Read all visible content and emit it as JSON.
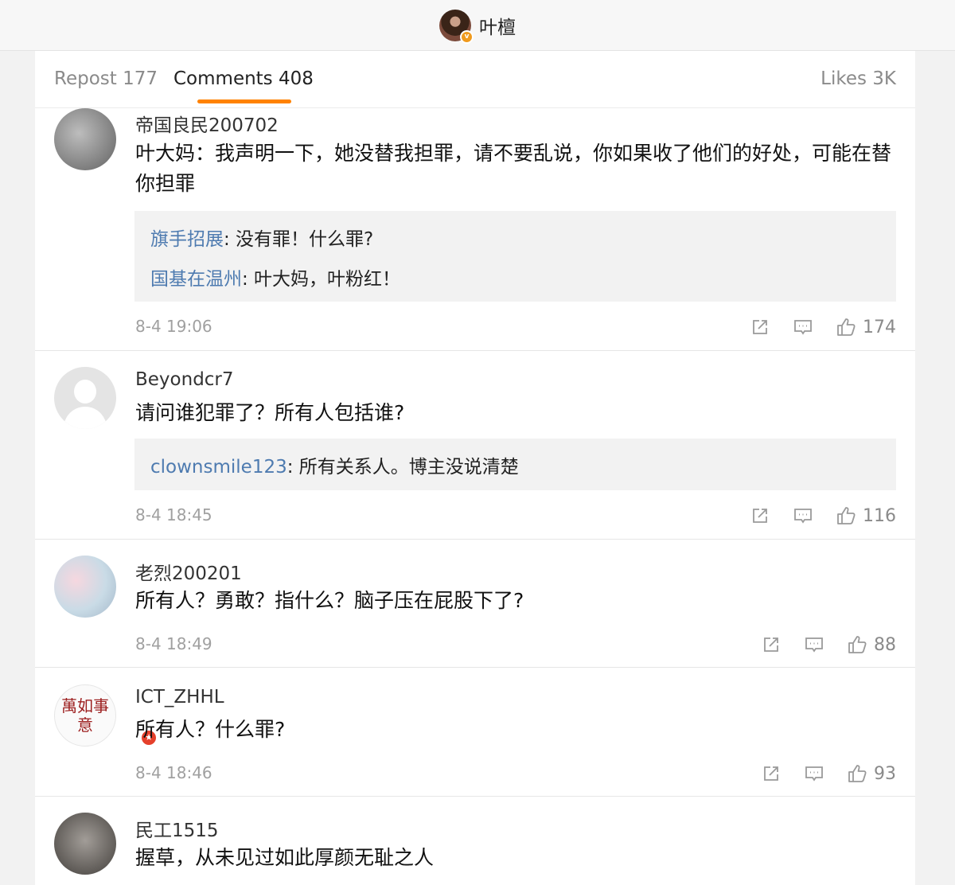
{
  "header": {
    "author_name": "叶檀",
    "verified_badge": "v"
  },
  "tabs": {
    "repost": "Repost 177",
    "comments": "Comments 408",
    "likes": "Likes 3K"
  },
  "colors": {
    "accent": "#ff8200",
    "reply_user": "#4e7bb0",
    "reply_background": "#f2f2f2"
  },
  "comments": [
    {
      "user": "帝国良民200702",
      "text": "叶大妈：我声明一下，她没替我担罪，请不要乱说，你如果收了他们的好处，可能在替你担罪",
      "replies": [
        {
          "user": "旗手招展",
          "text": ": 没有罪！什么罪?"
        },
        {
          "user": "国基在温州",
          "text": ": 叶大妈，叶粉红！"
        }
      ],
      "time": "8-4 19:06",
      "likes": "174"
    },
    {
      "user": "Beyondcr7",
      "text": "请问谁犯罪了？所有人包括谁?",
      "replies": [
        {
          "user": "clownsmile123",
          "text": ": 所有关系人。博主没说清楚"
        }
      ],
      "time": "8-4 18:45",
      "likes": "116"
    },
    {
      "user": "老烈200201",
      "text": "所有人？勇敢？指什么？脑子压在屁股下了?",
      "replies": [],
      "time": "8-4 18:49",
      "likes": "88"
    },
    {
      "user": "ICT_ZHHL",
      "text": "所有人？什么罪?",
      "replies": [],
      "time": "8-4 18:46",
      "likes": "93",
      "avatar_text": "萬如事意"
    },
    {
      "user": "民工1515",
      "text": "握草，从未见过如此厚颜无耻之人",
      "replies": []
    }
  ],
  "icons": {
    "share": "share-icon",
    "comment": "comment-icon",
    "like": "thumbs-up-icon",
    "avatar_badge": "★"
  }
}
